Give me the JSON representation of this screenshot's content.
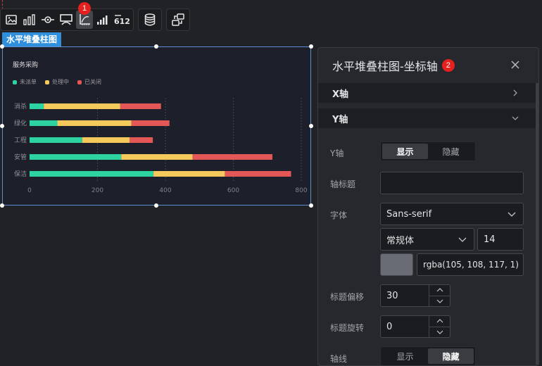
{
  "toolbar": {
    "groups": [
      [
        "image-icon",
        "bar-chart-icon",
        "target-icon",
        "display-icon",
        "axis-icon",
        "signal-icon",
        "number-icon"
      ],
      [
        "database-icon"
      ],
      [
        "exchange-icon"
      ]
    ],
    "active": "axis-icon",
    "badge": "1"
  },
  "widget": {
    "tag": "水平堆叠柱图"
  },
  "chart_data": {
    "type": "bar",
    "orientation": "horizontal",
    "stacked": true,
    "title": "服务采购",
    "categories": [
      "保洁",
      "安管",
      "工程",
      "绿化",
      "消杀"
    ],
    "series": [
      {
        "name": "未派单",
        "color": "#2ed3a2",
        "values": [
          365,
          270,
          155,
          82,
          42
        ]
      },
      {
        "name": "处理中",
        "color": "#f5c95c",
        "values": [
          210,
          210,
          140,
          218,
          225
        ]
      },
      {
        "name": "已关闭",
        "color": "#e35757",
        "values": [
          195,
          235,
          68,
          112,
          120
        ]
      }
    ],
    "x_ticks": [
      "0",
      "200",
      "400",
      "600",
      "800"
    ],
    "xlim": [
      0,
      800
    ],
    "grid": true,
    "legend": "top-left"
  },
  "panel": {
    "title": "水平堆叠柱图-坐标轴",
    "badge": "2",
    "sections": {
      "x": "X轴",
      "y": "Y轴"
    },
    "y_axis": {
      "label": "Y轴",
      "show": "显示",
      "hide": "隐藏",
      "selected": "显示"
    },
    "axis_title": {
      "label": "轴标题",
      "value": ""
    },
    "font": {
      "label": "字体",
      "family": "Sans-serif",
      "style": "常规体",
      "size": "14",
      "color_text": "rgba(105, 108, 117, 1)",
      "color": "#696c75"
    },
    "title_offset": {
      "label": "标题偏移",
      "value": "30"
    },
    "title_rotate": {
      "label": "标题旋转",
      "value": "0"
    },
    "axis_line": {
      "label": "轴线",
      "show": "显示",
      "hide": "隐藏",
      "selected": "隐藏"
    }
  }
}
